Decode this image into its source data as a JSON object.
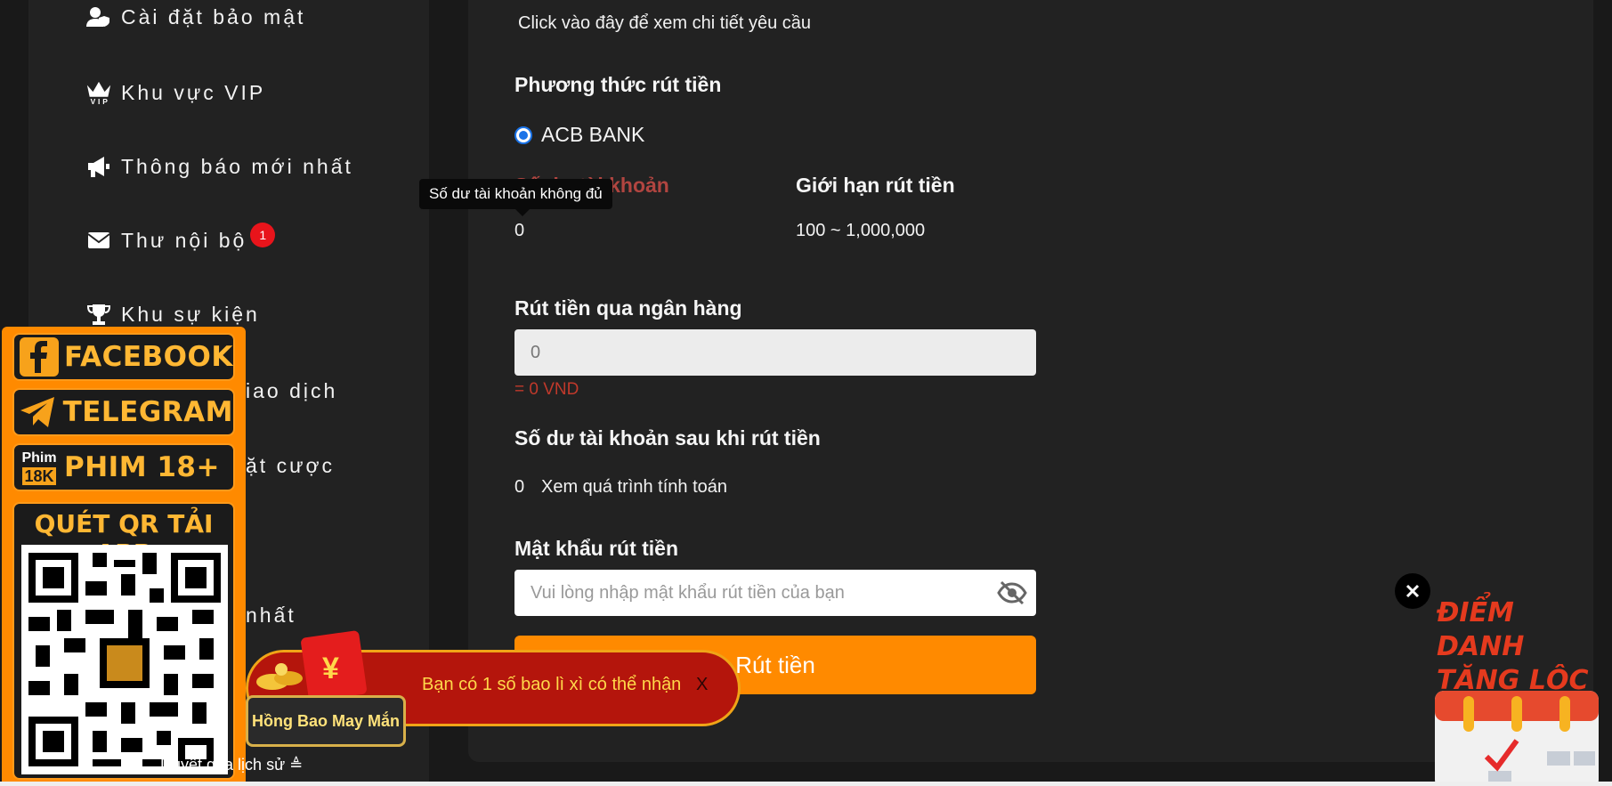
{
  "sidebar": {
    "items": [
      {
        "label": "Cài đặt bảo mật",
        "icon": "user-shield-icon"
      },
      {
        "label": "Khu vực VIP",
        "icon": "vip-crown-icon"
      },
      {
        "label": "Thông báo mới nhất",
        "icon": "megaphone-icon"
      },
      {
        "label": "Thư nội bộ",
        "icon": "envelope-icon",
        "badge": "1"
      },
      {
        "label": "Khu sự kiện",
        "icon": "trophy-icon"
      },
      {
        "label": "iao dịch"
      },
      {
        "label": "ặt cược"
      },
      {
        "label": "nhất"
      }
    ]
  },
  "tooltip": {
    "text": "Số dư tài khoản không đủ"
  },
  "main": {
    "request_link": "Click vào đây để xem chi tiết yêu cầu",
    "method_label": "Phương thức rút tiền",
    "bank_option": "ACB BANK",
    "balance_label": "Số dư tài khoản",
    "balance_value": "0",
    "limit_label": "Giới hạn rút tiền",
    "limit_value": "100 ~ 1,000,000",
    "bank_withdraw_label": "Rút tiền qua ngân hàng",
    "amount_placeholder": "0",
    "amount_equiv": "= 0 VND",
    "after_balance_label": "Số dư tài khoản sau khi rút tiền",
    "after_balance_value": "0",
    "calc_link": "Xem quá trình tính toán",
    "password_label": "Mật khẩu rút tiền",
    "password_placeholder": "Vui lòng nhập mật khẩu rút tiền của bạn",
    "submit_label": "Rút tiền"
  },
  "social": {
    "facebook": "FACEBOOK",
    "telegram": "TELEGRAM",
    "phim": "PHIM 18+",
    "phim_logo_top": "Phim",
    "phim_logo_bottom": "18K",
    "qr_title": "QUÉT QR TẢI APP"
  },
  "envelope": {
    "message": "Bạn có 1 số bao lì xì có thể nhận",
    "close": "X",
    "lucky_button": "Hồng Bao May Mắn"
  },
  "history_link": "Duyệt qua lịch sử ≜",
  "promo": {
    "title_line1": "ĐIỂM DANH",
    "title_line2": "TẶNG LỘC"
  },
  "colors": {
    "accent": "#ff8a00",
    "panel": "#222222",
    "background": "#191919",
    "error": "#c0392b",
    "badge": "#e8141b"
  }
}
